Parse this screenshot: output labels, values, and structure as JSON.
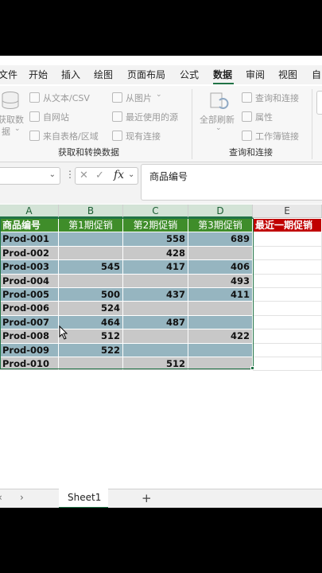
{
  "menu": {
    "items": [
      "文件",
      "开始",
      "插入",
      "绘图",
      "页面布局",
      "公式",
      "数据",
      "审阅",
      "视图",
      "自"
    ],
    "active": "数据"
  },
  "ribbon": {
    "get_data_label": "获取数",
    "get_data_label2": "据",
    "from_text_csv": "从文本/CSV",
    "from_web": "自网站",
    "from_table_range": "来自表格/区域",
    "from_picture": "从图片",
    "recent_sources": "最近使用的源",
    "existing_connections": "现有连接",
    "refresh_all": "全部刷新",
    "queries_connections": "查询和连接",
    "properties": "属性",
    "workbook_links": "工作簿链接",
    "group_get_transform": "获取和转换数据",
    "group_queries": "查询和连接"
  },
  "formula_bar": {
    "fx": "fx",
    "content": "商品编号"
  },
  "columns": [
    "A",
    "B",
    "C",
    "D",
    "E"
  ],
  "table": {
    "headers": [
      "商品编号",
      "第1期促销",
      "第2期促销",
      "第3期促销"
    ],
    "extra_header": "最近一期促销",
    "rows": [
      {
        "id": "Prod-001",
        "b": "",
        "c": "558",
        "d": "689"
      },
      {
        "id": "Prod-002",
        "b": "",
        "c": "428",
        "d": ""
      },
      {
        "id": "Prod-003",
        "b": "545",
        "c": "417",
        "d": "406"
      },
      {
        "id": "Prod-004",
        "b": "",
        "c": "",
        "d": "493"
      },
      {
        "id": "Prod-005",
        "b": "500",
        "c": "437",
        "d": "411"
      },
      {
        "id": "Prod-006",
        "b": "524",
        "c": "",
        "d": ""
      },
      {
        "id": "Prod-007",
        "b": "464",
        "c": "487",
        "d": ""
      },
      {
        "id": "Prod-008",
        "b": "512",
        "c": "",
        "d": "422"
      },
      {
        "id": "Prod-009",
        "b": "522",
        "c": "",
        "d": ""
      },
      {
        "id": "Prod-010",
        "b": "",
        "c": "512",
        "d": ""
      }
    ]
  },
  "sheet_tabs": {
    "active": "Sheet1",
    "add": "+"
  },
  "colors": {
    "header_green": "#3f8d2a",
    "header_red": "#c00000",
    "row_blue": "#96b5c0",
    "row_gray": "#c8c8c8",
    "excel_green": "#217346"
  }
}
